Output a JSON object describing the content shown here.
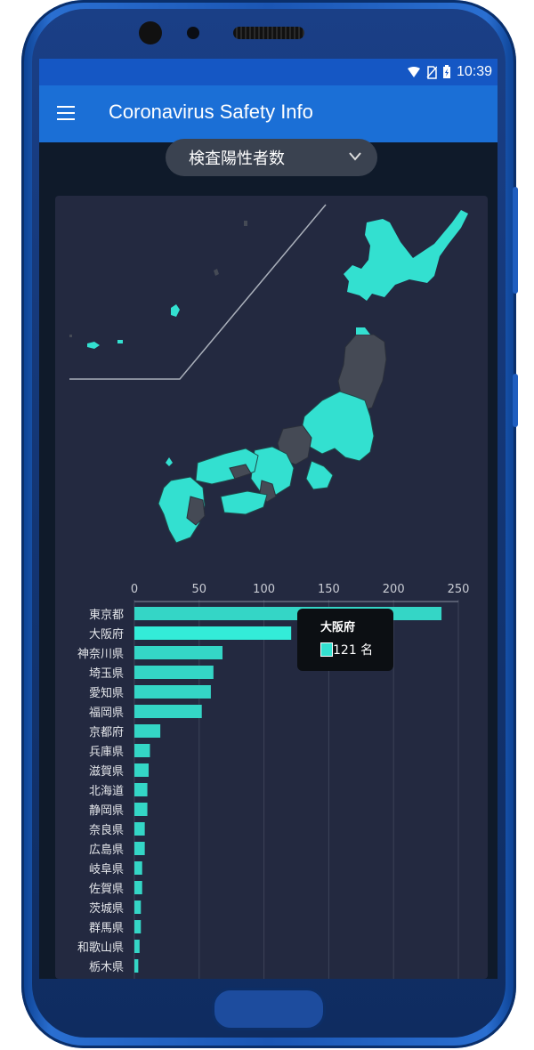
{
  "status_bar": {
    "time": "10:39"
  },
  "app_bar": {
    "title": "Coronavirus Safety Info"
  },
  "dropdown": {
    "selected": "検査陽性者数"
  },
  "tooltip": {
    "prefecture": "大阪府",
    "value": "121 名"
  },
  "colors": {
    "accent": "#33e0d0",
    "gray_region": "#454a55",
    "panel_bg": "#232940",
    "appbar": "#1b6fd6"
  },
  "chart_data": {
    "type": "bar",
    "orientation": "horizontal",
    "categories": [
      "東京都",
      "大阪府",
      "神奈川県",
      "埼玉県",
      "愛知県",
      "福岡県",
      "京都府",
      "兵庫県",
      "滋賀県",
      "北海道",
      "静岡県",
      "奈良県",
      "広島県",
      "岐阜県",
      "佐賀県",
      "茨城県",
      "群馬県",
      "和歌山県",
      "栃木県"
    ],
    "values": [
      237,
      121,
      68,
      61,
      59,
      52,
      20,
      12,
      11,
      10,
      10,
      8,
      8,
      6,
      6,
      5,
      5,
      4,
      3
    ],
    "xticks": [
      0,
      50,
      100,
      150,
      200,
      250
    ],
    "xlim": [
      0,
      250
    ],
    "grid": true,
    "title": "",
    "xlabel": "",
    "ylabel": ""
  }
}
